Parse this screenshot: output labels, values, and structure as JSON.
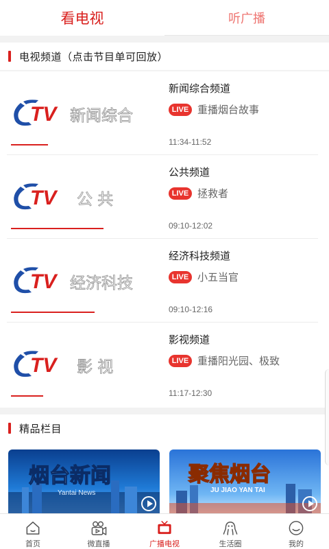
{
  "top_tabs": [
    {
      "label": "看电视",
      "active": true
    },
    {
      "label": "听广播",
      "active": false
    }
  ],
  "tv_section": {
    "title": "电视频道（点击节目单可回放）"
  },
  "channels": [
    {
      "name": "新闻综合频道",
      "logo_text": "新闻综合",
      "badge": "LIVE",
      "program": "重播烟台故事",
      "time": "11:34-11:52",
      "progress": 0.4
    },
    {
      "name": "公共频道",
      "logo_text": "公 共",
      "badge": "LIVE",
      "program": "拯救者",
      "time": "09:10-12:02",
      "progress": 1.0
    },
    {
      "name": "经济科技频道",
      "logo_text": "经济科技",
      "badge": "LIVE",
      "program": "小五当官",
      "time": "09:10-12:16",
      "progress": 0.9
    },
    {
      "name": "影视频道",
      "logo_text": "影 视",
      "badge": "LIVE",
      "program": "重播阳光园、极致",
      "time": "11:17-12:30",
      "progress": 0.35
    }
  ],
  "featured_section": {
    "title": "精品栏目"
  },
  "featured_cards": [
    {
      "title": "烟台新闻",
      "subtitle": "Yantai News"
    },
    {
      "title": "聚焦烟台",
      "subtitle": "JU JIAO YAN TAI"
    }
  ],
  "bottom_nav": [
    {
      "label": "首页",
      "icon": "home-icon",
      "active": false
    },
    {
      "label": "微直播",
      "icon": "video-camera-icon",
      "active": false
    },
    {
      "label": "广播电视",
      "icon": "tv-icon",
      "active": true
    },
    {
      "label": "生活圈",
      "icon": "octopus-icon",
      "active": false
    },
    {
      "label": "我的",
      "icon": "profile-icon",
      "active": false
    }
  ],
  "colors": {
    "accent": "#d9201e",
    "live_badge": "#e8342e",
    "logo_blue": "#1f4fa8"
  }
}
